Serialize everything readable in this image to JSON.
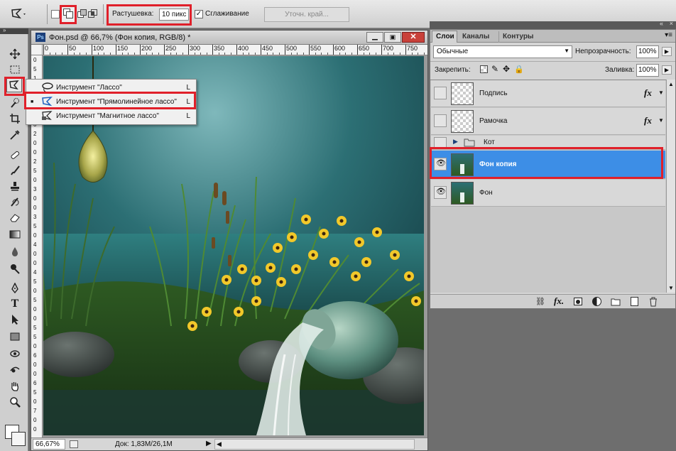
{
  "options_bar": {
    "feather_label": "Растушевка:",
    "feather_value": "10 пикс",
    "antialias_label": "Сглаживание",
    "antialias_checked": true,
    "refine_edge_label": "Уточн. край..."
  },
  "toolbox": {
    "expand_icon": "double-chevron-right-icon"
  },
  "document": {
    "title": "Фон.psd @ 66,7% (Фон копия, RGB/8) *",
    "ps_badge": "Ps",
    "ruler_h_ticks": [
      "0",
      "50",
      "100",
      "150",
      "200",
      "250",
      "300",
      "350",
      "400",
      "450",
      "500",
      "550",
      "600",
      "650",
      "700",
      "750"
    ],
    "ruler_v_ticks": [
      "0",
      "5",
      "1",
      "0",
      "0",
      "1",
      "5",
      "0",
      "2",
      "0",
      "0",
      "2",
      "5",
      "0",
      "3",
      "0",
      "0",
      "3",
      "5",
      "0",
      "4",
      "0",
      "0",
      "4",
      "5",
      "0",
      "5",
      "0",
      "0",
      "5",
      "5",
      "0",
      "6",
      "0",
      "0",
      "6",
      "5",
      "0",
      "7",
      "0",
      "0"
    ],
    "zoom": "66,67%",
    "doc_info": "Док: 1,83M/26,1M"
  },
  "lasso_flyout": {
    "items": [
      {
        "label": "Инструмент \"Лассо\"",
        "key": "L",
        "icon": "lasso-icon",
        "selected": false
      },
      {
        "label": "Инструмент \"Прямолинейное лассо\"",
        "key": "L",
        "icon": "polygonal-lasso-icon",
        "selected": true
      },
      {
        "label": "Инструмент \"Магнитное лассо\"",
        "key": "L",
        "icon": "magnetic-lasso-icon",
        "selected": false
      }
    ],
    "selected_marker": "■"
  },
  "layers_panel": {
    "tabs": [
      "Слои",
      "Каналы",
      "Контуры"
    ],
    "active_tab": "Слои",
    "blend_mode": "Обычные",
    "opacity_label": "Непрозрачность:",
    "opacity_value": "100%",
    "lock_label": "Закрепить:",
    "fill_label": "Заливка:",
    "fill_value": "100%",
    "fx_label": "fx",
    "layers": [
      {
        "name": "Подпись",
        "visible": false,
        "type": "transparent",
        "fx": true,
        "selected": false
      },
      {
        "name": "Рамочка",
        "visible": false,
        "type": "transparent",
        "fx": true,
        "selected": false
      },
      {
        "name": "Кот",
        "visible": false,
        "type": "group",
        "fx": false,
        "selected": false
      },
      {
        "name": "Фон копия",
        "visible": true,
        "type": "image",
        "fx": false,
        "selected": true
      },
      {
        "name": "Фон",
        "visible": true,
        "type": "image",
        "fx": false,
        "selected": false
      }
    ]
  },
  "colors": {
    "selection_blue": "#3d8ee6",
    "highlight_red": "#e0202a"
  }
}
